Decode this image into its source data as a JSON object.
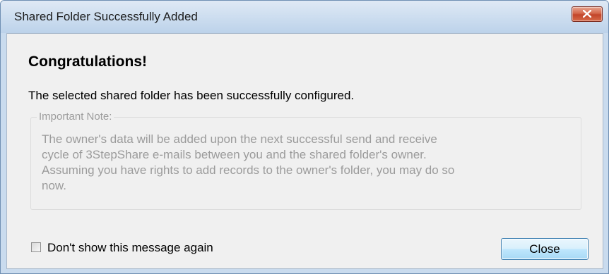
{
  "window": {
    "title": "Shared Folder Successfully Added",
    "close_icon": "close-x-icon"
  },
  "content": {
    "heading": "Congratulations!",
    "message": "The selected shared folder has been successfully configured.",
    "note": {
      "label": "Important Note:",
      "lines": [
        "The owner's data will be added upon the next successful send and receive",
        "cycle of 3StepShare e-mails between you and the shared folder's owner.",
        "Assuming you have rights to add records to the owner's folder, you may do so",
        "now."
      ]
    }
  },
  "footer": {
    "checkbox_label": "Don't show this message again",
    "checkbox_checked": false,
    "close_button_label": "Close"
  },
  "colors": {
    "titlebar": "#cfdff0",
    "client_bg": "#f0f0f0",
    "close_x_red": "#c2452a",
    "button_border": "#3c7fb1",
    "note_text": "#9b9b9b"
  }
}
